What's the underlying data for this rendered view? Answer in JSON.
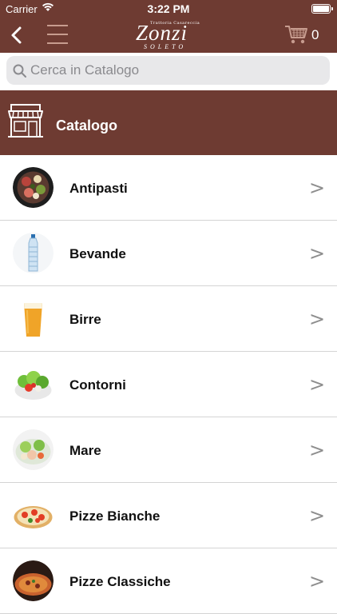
{
  "status_bar": {
    "carrier": "Carrier",
    "time": "3:22 PM"
  },
  "nav": {
    "logo_tagline": "Trattoria Casareccia",
    "logo_name": "Zonzi",
    "logo_city": "SOLETO",
    "cart_count": "0",
    "icons": [
      "back-chevron-icon",
      "hamburger-menu-icon",
      "cart-icon"
    ]
  },
  "search": {
    "placeholder": "Cerca in Catalogo"
  },
  "catalog_header": {
    "title": "Catalogo",
    "icon": "store-icon"
  },
  "categories": [
    {
      "label": "Antipasti",
      "thumb": "antipasti-plate"
    },
    {
      "label": "Bevande",
      "thumb": "water-bottle"
    },
    {
      "label": "Birre",
      "thumb": "beer-glass"
    },
    {
      "label": "Contorni",
      "thumb": "salad-bowl"
    },
    {
      "label": "Mare",
      "thumb": "seafood-salad"
    },
    {
      "label": "Pizze Bianche",
      "thumb": "pizza"
    },
    {
      "label": "Pizze Classiche",
      "thumb": "pizza-dark"
    }
  ],
  "chevron": ">",
  "colors": {
    "brand_brown": "#6e3b32",
    "search_bg": "#e8e8ea",
    "divider": "#d4d4d4",
    "chevron": "#8e8e8e"
  }
}
